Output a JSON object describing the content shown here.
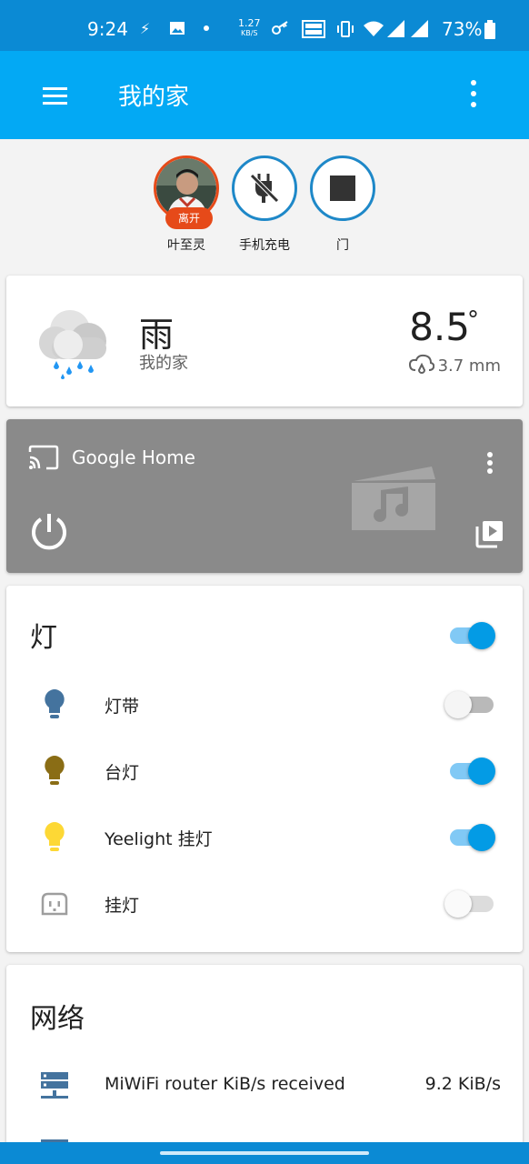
{
  "status_bar": {
    "time": "9:24",
    "speed_value": "1.27",
    "speed_unit": "KB/S",
    "battery": "73%"
  },
  "app_bar": {
    "title": "我的家"
  },
  "badges": [
    {
      "label": "叶至灵",
      "state": "离开",
      "icon": "person-avatar"
    },
    {
      "label": "手机充电",
      "icon": "power-plug-off-icon"
    },
    {
      "label": "门",
      "icon": "stop-icon"
    }
  ],
  "weather": {
    "condition": "雨",
    "location": "我的家",
    "temperature": "8.5",
    "temperature_unit": "°",
    "precipitation": "3.7 mm"
  },
  "media": {
    "name": "Google Home"
  },
  "lights": {
    "title": "灯",
    "master_on": true,
    "items": [
      {
        "label": "灯带",
        "on": false,
        "icon_color": "#44739e"
      },
      {
        "label": "台灯",
        "on": true,
        "icon_color": "#8a6d15"
      },
      {
        "label": "Yeelight 挂灯",
        "on": true,
        "icon_color": "#fdd835"
      },
      {
        "label": "挂灯",
        "on": false,
        "unavailable": true
      }
    ]
  },
  "network": {
    "title": "网络",
    "items": [
      {
        "label": "MiWiFi router KiB/s received",
        "value": "9.2 KiB/s"
      }
    ]
  },
  "colors": {
    "primary": "#03a9f4",
    "status_bar": "#0b8ad4",
    "accent": "#039be5",
    "away_badge": "#e64a19"
  }
}
